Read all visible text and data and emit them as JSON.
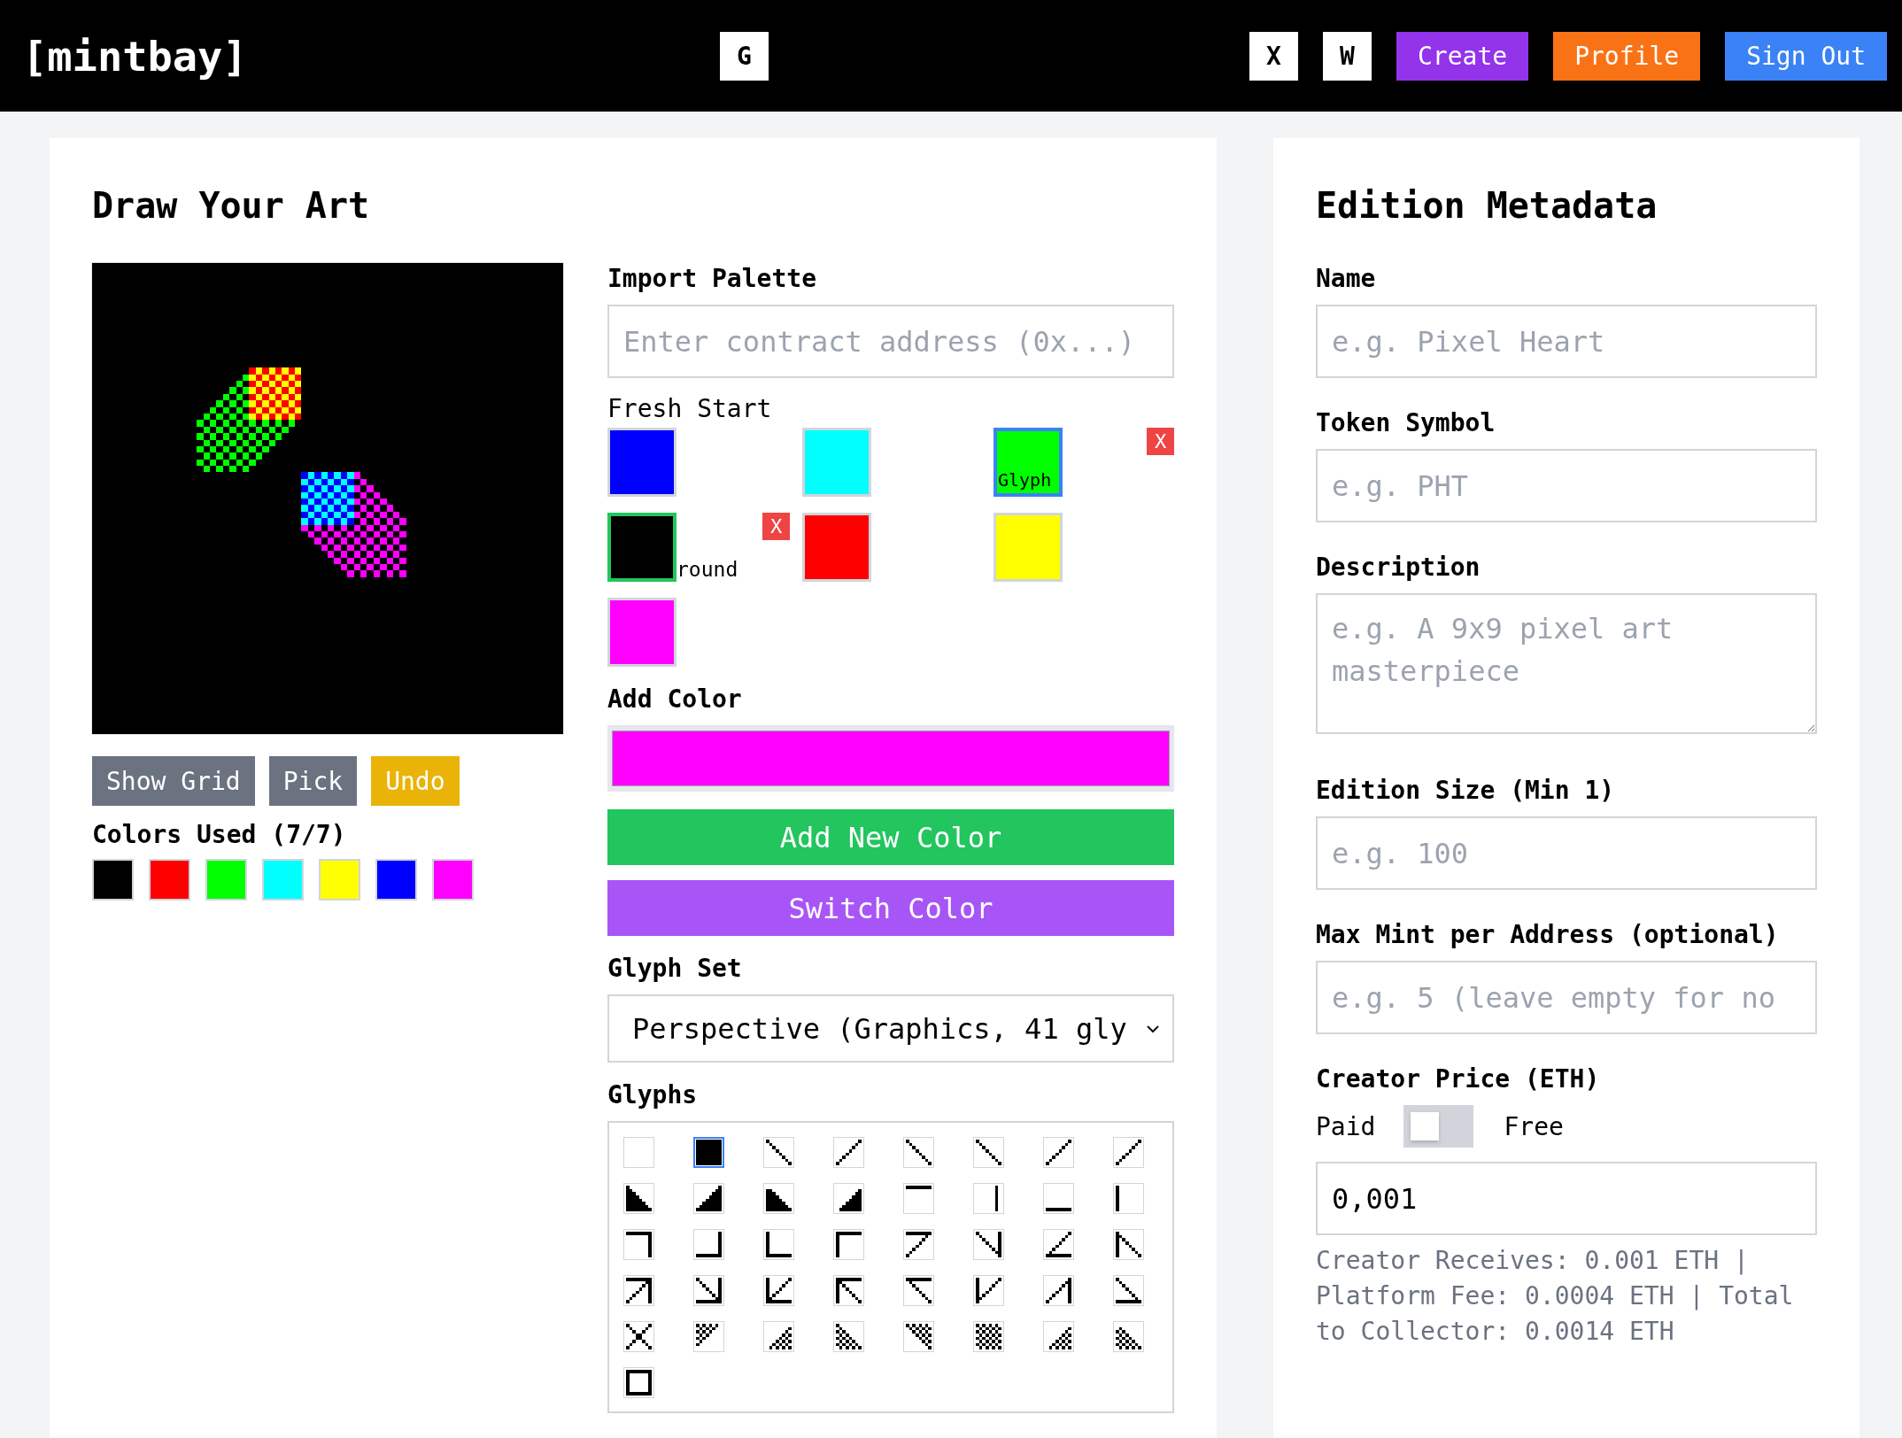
{
  "header": {
    "logo": "[mintbay]",
    "center_buttons": [
      {
        "label": "G"
      }
    ],
    "right_buttons": [
      {
        "label": "X",
        "kind": "square"
      },
      {
        "label": "W",
        "kind": "square"
      },
      {
        "label": "Create",
        "kind": "filled",
        "color": "#9333ea"
      },
      {
        "label": "Profile",
        "kind": "filled",
        "color": "#f97316"
      },
      {
        "label": "Sign Out",
        "kind": "filled",
        "color": "#3b82f6"
      }
    ]
  },
  "draw_panel": {
    "title": "Draw Your Art",
    "tool_buttons": [
      {
        "label": "Show Grid",
        "color": "#6b7280"
      },
      {
        "label": "Pick",
        "color": "#6b7280"
      },
      {
        "label": "Undo",
        "color": "#eab308"
      }
    ],
    "colors_used": {
      "label": "Colors Used (7/7)",
      "swatches": [
        {
          "color": "#000000"
        },
        {
          "color": "#ff0000"
        },
        {
          "color": "#00ff00"
        },
        {
          "color": "#00ffff"
        },
        {
          "color": "#ffff00"
        },
        {
          "color": "#0000ff"
        },
        {
          "color": "#ff00ff"
        }
      ]
    },
    "import_palette": {
      "label": "Import Palette",
      "placeholder": "Enter contract address (0x...)"
    },
    "palette": {
      "name": "Fresh Start",
      "items": [
        {
          "color": "#0000ff",
          "kind": "plain"
        },
        {
          "color": "#00ffff",
          "kind": "plain"
        },
        {
          "color": "#00ff00",
          "kind": "glyph",
          "label": "Glyph",
          "remove": "X"
        },
        {
          "color": "#000000",
          "kind": "background",
          "label": "round",
          "remove": "X"
        },
        {
          "color": "#ff0000",
          "kind": "plain"
        },
        {
          "color": "#ffff00",
          "kind": "plain"
        },
        {
          "color": "#ff00ff",
          "kind": "plain"
        }
      ]
    },
    "add_color": {
      "label": "Add Color",
      "color": "#ff00ff",
      "buttons": [
        {
          "label": "Add New Color",
          "color": "#22c55e"
        },
        {
          "label": "Switch Color",
          "color": "#a855f7"
        }
      ]
    },
    "glyph_set": {
      "label": "Glyph Set",
      "value": "Perspective (Graphics, 41 gly"
    },
    "glyphs": {
      "label": "Glyphs",
      "items": [
        {
          "selected": false
        },
        {
          "selected": true
        },
        {
          "selected": false
        },
        {
          "selected": false
        },
        {
          "selected": false
        },
        {
          "selected": false
        },
        {
          "selected": false
        },
        {
          "selected": false
        },
        {
          "selected": false
        },
        {
          "selected": false
        },
        {
          "selected": false
        },
        {
          "selected": false
        },
        {
          "selected": false
        },
        {
          "selected": false
        },
        {
          "selected": false
        },
        {
          "selected": false
        },
        {
          "selected": false
        },
        {
          "selected": false
        },
        {
          "selected": false
        },
        {
          "selected": false
        },
        {
          "selected": false
        },
        {
          "selected": false
        },
        {
          "selected": false
        },
        {
          "selected": false
        },
        {
          "selected": false
        },
        {
          "selected": false
        },
        {
          "selected": false
        },
        {
          "selected": false
        },
        {
          "selected": false
        },
        {
          "selected": false
        },
        {
          "selected": false
        },
        {
          "selected": false
        },
        {
          "selected": false
        },
        {
          "selected": false
        },
        {
          "selected": false
        },
        {
          "selected": false
        },
        {
          "selected": false
        },
        {
          "selected": false
        },
        {
          "selected": false
        },
        {
          "selected": false
        },
        {
          "selected": false
        }
      ]
    }
  },
  "metadata_panel": {
    "title": "Edition Metadata",
    "fields": [
      {
        "label": "Name",
        "kind": "input",
        "placeholder": "e.g. Pixel Heart"
      },
      {
        "label": "Token Symbol",
        "kind": "input",
        "placeholder": "e.g. PHT"
      },
      {
        "label": "Description",
        "kind": "textarea",
        "placeholder": "e.g. A 9x9 pixel art masterpiece"
      },
      {
        "label": "Edition Size (Min 1)",
        "kind": "input",
        "placeholder": "e.g. 100"
      },
      {
        "label": "Max Mint per Address (optional)",
        "kind": "input",
        "placeholder": "e.g. 5 (leave empty for no"
      }
    ],
    "price": {
      "label": "Creator Price (ETH)",
      "toggle_left": "Paid",
      "toggle_right": "Free",
      "on": false,
      "value": "0,001",
      "summary": "Creator Receives: 0.001 ETH | Platform Fee: 0.0004 ETH | Total to Collector: 0.0014 ETH"
    }
  }
}
